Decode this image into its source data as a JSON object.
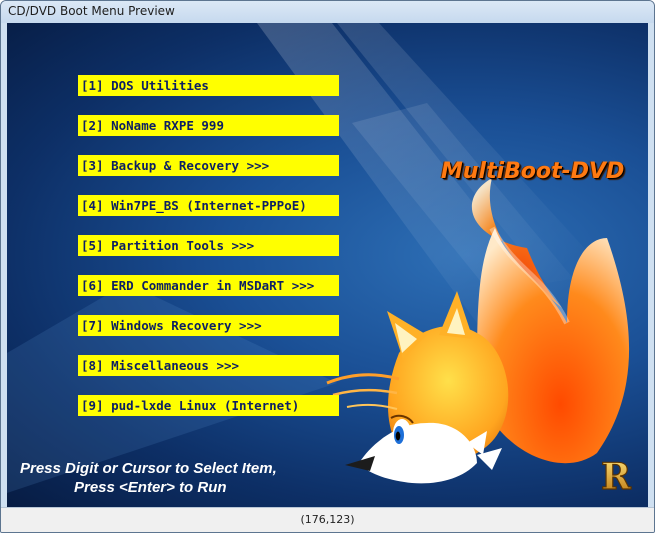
{
  "window": {
    "title": "CD/DVD Boot Menu Preview"
  },
  "menu": {
    "items": [
      "[1] DOS Utilities",
      "[2] NoName RXPE 999",
      "[3] Backup & Recovery >>>",
      "[4] Win7PE_BS (Internet-PPPoE)",
      "[5] Partition Tools >>>",
      "[6] ERD Commander in MSDaRT >>>",
      "[7] Windows Recovery >>>",
      "[8] Miscellaneous >>>",
      "[9] pud-lxde Linux (Internet)"
    ]
  },
  "brand": {
    "text": "MultiBoot-DVD",
    "color": "#ff7a12"
  },
  "instructions": {
    "line1": "Press Digit or Cursor to Select Item,",
    "line2": "Press <Enter> to Run"
  },
  "logo": {
    "letter": "R",
    "icon": "r-logo-icon"
  },
  "status": {
    "coords": "(176,123)"
  },
  "colors": {
    "menu_bg": "#ffff00",
    "menu_text": "#0c1f63",
    "background": "#1a4f95"
  }
}
